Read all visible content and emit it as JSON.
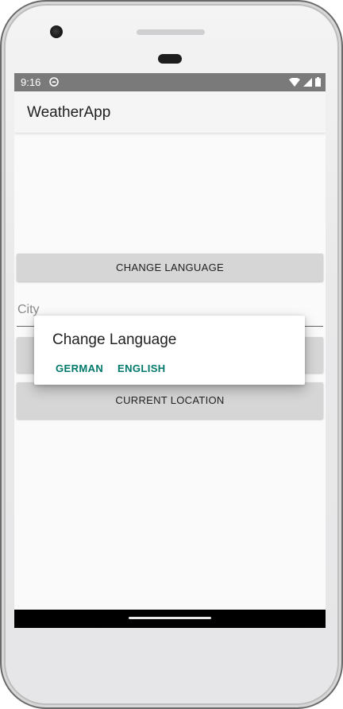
{
  "status_bar": {
    "time": "9:16",
    "icons": [
      "app-notification-icon",
      "wifi-icon",
      "cell-signal-icon",
      "battery-icon"
    ]
  },
  "app_bar": {
    "title": "WeatherApp"
  },
  "main": {
    "change_language_label": "CHANGE LANGUAGE",
    "city_placeholder": "City",
    "current_location_label": "CURRENT LOCATION"
  },
  "dialog": {
    "title": "Change Language",
    "options": [
      "GERMAN",
      "ENGLISH"
    ]
  },
  "colors": {
    "accent": "#00796b",
    "status_bar": "#7a7a7a",
    "button": "#d6d6d6"
  }
}
